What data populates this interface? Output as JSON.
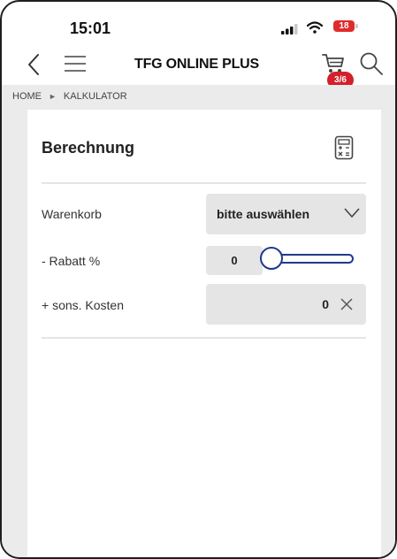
{
  "status_bar": {
    "time": "15:01",
    "battery": "18"
  },
  "nav": {
    "title": "TFG ONLINE PLUS",
    "cart_badge": "3/6"
  },
  "breadcrumb": [
    "HOME",
    "KALKULATOR"
  ],
  "card": {
    "title": "Berechnung",
    "rows": {
      "warenkorb": {
        "label": "Warenkorb",
        "value": "bitte auswählen"
      },
      "rabatt": {
        "label": "- Rabatt %",
        "value": "0",
        "slider_fraction": 0
      },
      "kosten": {
        "label": "+ sons. Kosten",
        "value": "0"
      }
    }
  },
  "colors": {
    "accent": "#1f3a8a",
    "badge": "#d3202a",
    "background": "#ebebeb"
  },
  "icons": [
    "back-icon",
    "menu-icon",
    "cart-icon",
    "search-icon",
    "calculator-icon",
    "chevron-down-icon",
    "close-icon"
  ]
}
